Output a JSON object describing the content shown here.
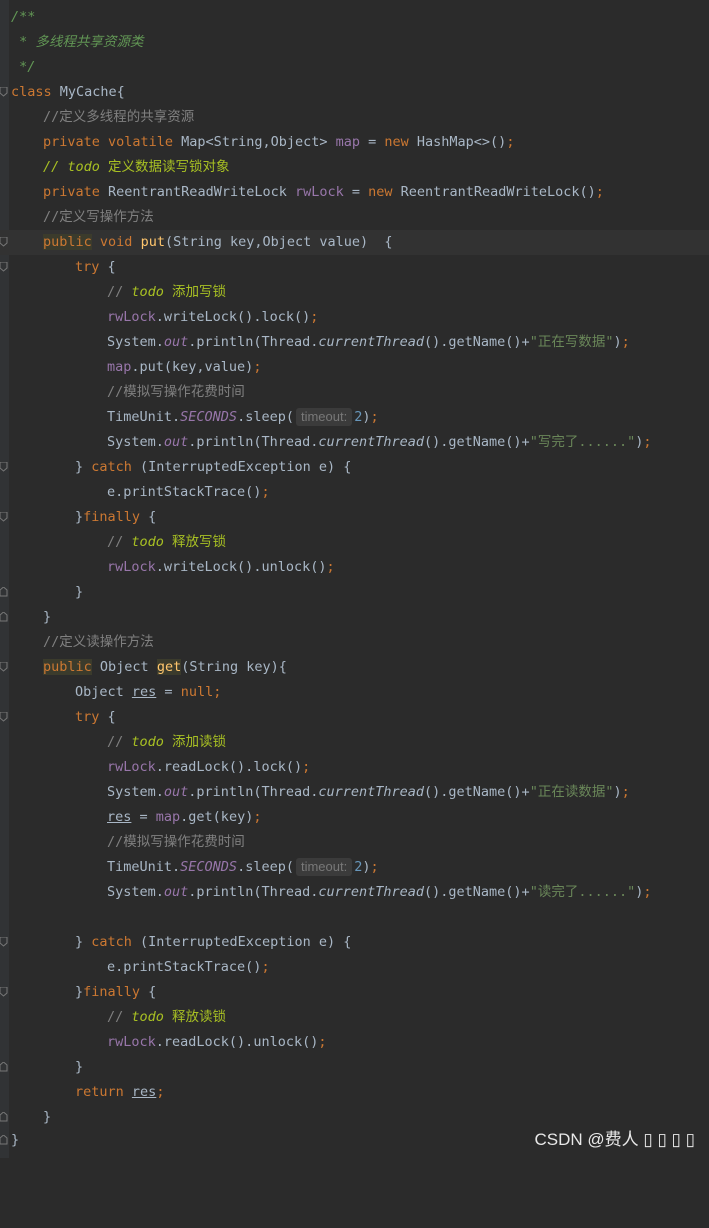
{
  "lines": {
    "l1": "/**",
    "l2": " * 多线程共享资源类",
    "l3": " */",
    "l4_kw": "class",
    "l4_rest": " MyCache{",
    "l5": "//定义多线程的共享资源",
    "l6_a": "private volatile",
    "l6_b": " Map<String,Object> ",
    "l6_c": "map",
    "l6_d": " = ",
    "l6_e": "new",
    "l6_f": " HashMap<>()",
    "l6_g": ";",
    "l7_a": "// ",
    "l7_b": "todo",
    "l7_c": " 定义数据读写锁对象",
    "l8_a": "private",
    "l8_b": " ReentrantReadWriteLock ",
    "l8_c": "rwLock",
    "l8_d": " = ",
    "l8_e": "new",
    "l8_f": " ReentrantReadWriteLock()",
    "l8_g": ";",
    "l9": "//定义写操作方法",
    "l10_a": "public",
    "l10_b": " void ",
    "l10_c": "put",
    "l10_d": "(String key,Object value)  {",
    "l11": "try",
    "l11_b": " {",
    "l12_a": "// ",
    "l12_b": "todo",
    "l12_c": " 添加写锁",
    "l13_a": "rwLock",
    "l13_b": ".writeLock().lock()",
    "l13_c": ";",
    "l14_a": "System.",
    "l14_b": "out",
    "l14_c": ".println(Thread.",
    "l14_d": "currentThread",
    "l14_e": "().getName()+",
    "l14_f": "\"正在写数据\"",
    "l14_g": ")",
    "l14_h": ";",
    "l15_a": "map",
    "l15_b": ".put(key,value)",
    "l15_c": ";",
    "l16": "//模拟写操作花费时间",
    "l17_a": "TimeUnit.",
    "l17_b": "SECONDS",
    "l17_c": ".sleep(",
    "l17_hint": "timeout:",
    "l17_d": "2",
    "l17_e": ")",
    "l17_f": ";",
    "l18_a": "System.",
    "l18_b": "out",
    "l18_c": ".println(Thread.",
    "l18_d": "currentThread",
    "l18_e": "().getName()+",
    "l18_f": "\"写完了......\"",
    "l18_g": ")",
    "l18_h": ";",
    "l19_a": "} ",
    "l19_b": "catch",
    "l19_c": " (InterruptedException e) {",
    "l20_a": "e.printStackTrace()",
    "l20_b": ";",
    "l21_a": "}",
    "l21_b": "finally",
    "l21_c": " {",
    "l22_a": "// ",
    "l22_b": "todo",
    "l22_c": " 释放写锁",
    "l23_a": "rwLock",
    "l23_b": ".writeLock().unlock()",
    "l23_c": ";",
    "l24": "}",
    "l25": "}",
    "l26": "//定义读操作方法",
    "l27_a": "public",
    "l27_b": " Object ",
    "l27_c": "get",
    "l27_d": "(String key){",
    "l28_a": "Object ",
    "l28_b": "res",
    "l28_c": " = ",
    "l28_d": "null",
    "l28_e": ";",
    "l29": "try",
    "l29_b": " {",
    "l30_a": "// ",
    "l30_b": "todo",
    "l30_c": " 添加读锁",
    "l31_a": "rwLock",
    "l31_b": ".readLock().lock()",
    "l31_c": ";",
    "l32_a": "System.",
    "l32_b": "out",
    "l32_c": ".println(Thread.",
    "l32_d": "currentThread",
    "l32_e": "().getName()+",
    "l32_f": "\"正在读数据\"",
    "l32_g": ")",
    "l32_h": ";",
    "l33_a": "res",
    "l33_b": " = ",
    "l33_c": "map",
    "l33_d": ".get(key)",
    "l33_e": ";",
    "l34": "//模拟写操作花费时间",
    "l35_a": "TimeUnit.",
    "l35_b": "SECONDS",
    "l35_c": ".sleep(",
    "l35_hint": "timeout:",
    "l35_d": "2",
    "l35_e": ")",
    "l35_f": ";",
    "l36_a": "System.",
    "l36_b": "out",
    "l36_c": ".println(Thread.",
    "l36_d": "currentThread",
    "l36_e": "().getName()+",
    "l36_f": "\"读完了......\"",
    "l36_g": ")",
    "l36_h": ";",
    "l38_a": "} ",
    "l38_b": "catch",
    "l38_c": " (InterruptedException e) {",
    "l39_a": "e.printStackTrace()",
    "l39_b": ";",
    "l40_a": "}",
    "l40_b": "finally",
    "l40_c": " {",
    "l41_a": "// ",
    "l41_b": "todo",
    "l41_c": " 释放读锁",
    "l42_a": "rwLock",
    "l42_b": ".readLock().unlock()",
    "l42_c": ";",
    "l43": "}",
    "l44_a": "return",
    "l44_b": " ",
    "l44_c": "res",
    "l44_d": ";",
    "l45": "}",
    "l46": "}"
  },
  "watermark": "CSDN @费人 ▯ ▯ ▯ ▯",
  "colors": {
    "background": "#2b2b2b",
    "keyword": "#cc7832",
    "doc_comment": "#629755",
    "line_comment": "#808080",
    "todo": "#a8c023",
    "string": "#6a8759",
    "field": "#9876aa",
    "number": "#6897bb",
    "method_decl": "#ffc66d"
  }
}
